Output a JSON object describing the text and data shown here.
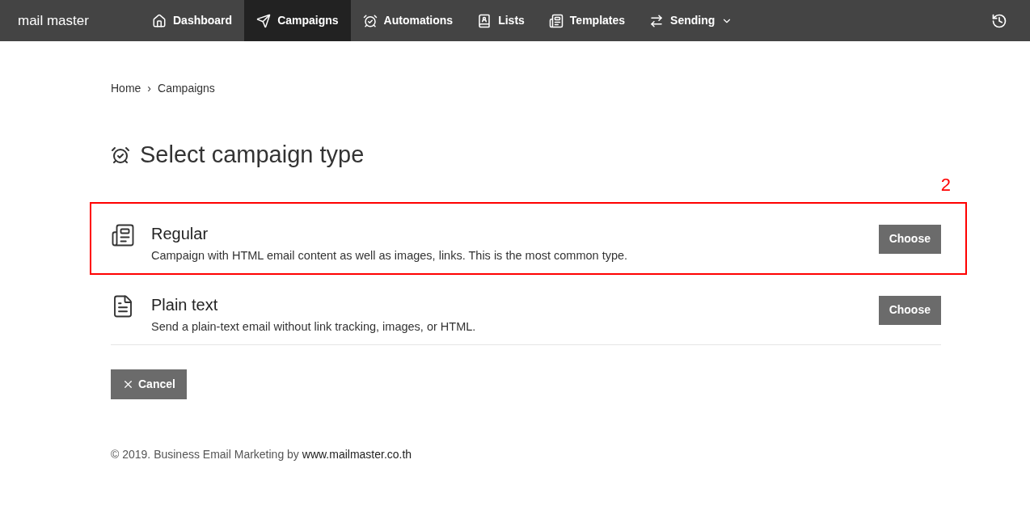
{
  "navbar": {
    "logo": "mail master",
    "items": [
      {
        "label": "Dashboard",
        "kind": "home",
        "selected": false,
        "dropdown": false
      },
      {
        "label": "Campaigns",
        "kind": "send",
        "selected": true,
        "dropdown": false
      },
      {
        "label": "Automations",
        "kind": "alarm",
        "selected": false,
        "dropdown": false
      },
      {
        "label": "Lists",
        "kind": "contacts",
        "selected": false,
        "dropdown": false
      },
      {
        "label": "Templates",
        "kind": "newspaper",
        "selected": false,
        "dropdown": false
      },
      {
        "label": "Sending",
        "kind": "swap",
        "selected": false,
        "dropdown": true
      }
    ]
  },
  "breadcrumb": [
    "Home",
    "›",
    "Campaigns"
  ],
  "page_title": "Select campaign type",
  "options": [
    {
      "kind": "regular",
      "title": "Regular",
      "description": "Campaign with HTML email content as well as images, links. This is the most common type.",
      "button": "Choose",
      "highlighted": true,
      "annotation": "2"
    },
    {
      "kind": "plain",
      "title": "Plain text",
      "description": "Send a plain-text email without link tracking, images, or HTML.",
      "button": "Choose",
      "highlighted": false
    }
  ],
  "cancel_button": "Cancel",
  "footer": {
    "text": "© 2019. Business Email Marketing by ",
    "link": "www.mailmaster.co.th"
  }
}
